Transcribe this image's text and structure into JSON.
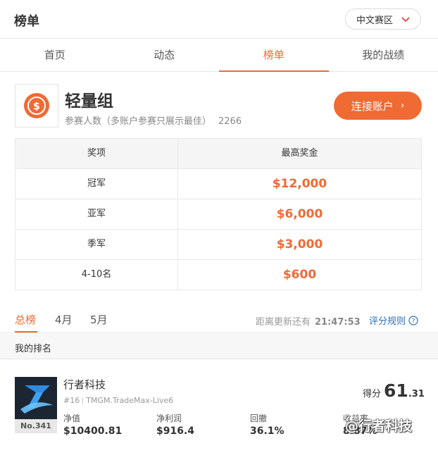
{
  "header": {
    "title": "榜单",
    "region": "中文赛区"
  },
  "tabs": [
    {
      "label": "首页"
    },
    {
      "label": "动态"
    },
    {
      "label": "榜单"
    },
    {
      "label": "我的战绩"
    }
  ],
  "group": {
    "name": "轻量组",
    "participants_label": "参赛人数（多账户参赛只展示最佳）",
    "participants_count": "2266",
    "connect_label": "连接账户",
    "connect_arrow": "›"
  },
  "prize_table": {
    "headers": [
      "奖项",
      "最高奖金"
    ],
    "rows": [
      {
        "place": "冠军",
        "amount": "$12,000"
      },
      {
        "place": "亚军",
        "amount": "$6,000"
      },
      {
        "place": "季军",
        "amount": "$3,000"
      },
      {
        "place": "4-10名",
        "amount": "$600"
      }
    ]
  },
  "subtabs": [
    {
      "label": "总榜"
    },
    {
      "label": "4月"
    },
    {
      "label": "5月"
    }
  ],
  "update": {
    "label": "距离更新还有",
    "time": "21:47:53"
  },
  "rules_label": "评分规则",
  "my_rank_label": "我的排名",
  "entry": {
    "name": "行者科技",
    "rank_no": "#16",
    "server": "TMGM.TradeMax-Live6",
    "badge": "No.341",
    "score_label": "得分",
    "score_int": "61",
    "score_dec": ".31",
    "stats": [
      {
        "label": "净值",
        "value": "$10400.81"
      },
      {
        "label": "净利润",
        "value": "$916.4"
      },
      {
        "label": "回撤",
        "value": "36.1%"
      },
      {
        "label": "收益率",
        "value": "8.87%"
      }
    ]
  },
  "watermark": "@行者科技",
  "colors": {
    "accent": "#f06a34",
    "link": "#2a6fb3"
  }
}
